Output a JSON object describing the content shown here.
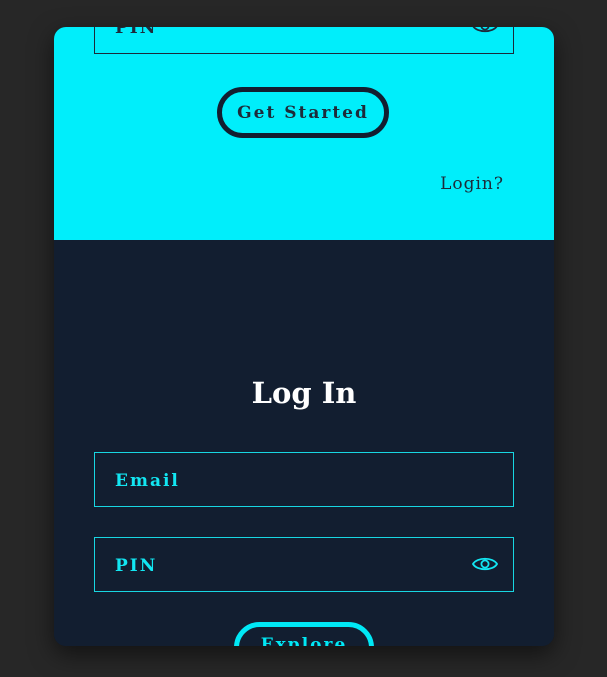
{
  "colors": {
    "page_background": "#272727",
    "top_panel": "#00eefb",
    "bottom_panel": "#121e30",
    "accent": "#00e8f5",
    "dark_text": "#1d2b3a"
  },
  "signup": {
    "pin_label": "PIN",
    "pin_icon": "eye-icon",
    "button_label": "Get Started",
    "login_link": "Login?"
  },
  "login": {
    "title": "Log In",
    "email_label": "Email",
    "pin_label": "PIN",
    "pin_icon": "eye-icon",
    "button_label": "Explore"
  }
}
